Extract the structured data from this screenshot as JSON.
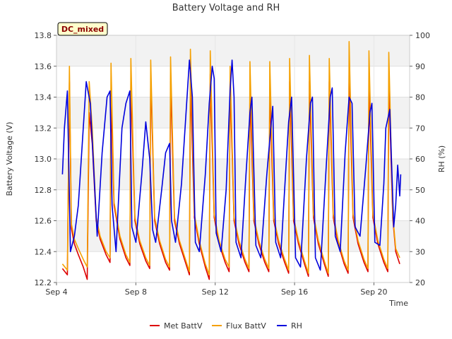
{
  "chart_data": {
    "type": "line",
    "title": "Battery Voltage and RH",
    "badge": "DC_mixed",
    "xlabel": "Time",
    "ylabel": "Battery Voltage (V)",
    "y2label": "RH (%)",
    "x_range_days": [
      4,
      21.8
    ],
    "x_ticks": [
      {
        "day": 4,
        "label": "Sep 4"
      },
      {
        "day": 8,
        "label": "Sep 8"
      },
      {
        "day": 12,
        "label": "Sep 12"
      },
      {
        "day": 16,
        "label": "Sep 16"
      },
      {
        "day": 20,
        "label": "Sep 20"
      }
    ],
    "ylim": [
      12.2,
      13.8
    ],
    "y_ticks": [
      "12.2",
      "12.4",
      "12.6",
      "12.8",
      "13.0",
      "13.2",
      "13.4",
      "13.6",
      "13.8"
    ],
    "y2lim": [
      20,
      100
    ],
    "y2_ticks": [
      "20",
      "30",
      "40",
      "50",
      "60",
      "70",
      "80",
      "90",
      "100"
    ],
    "legend_position": "bottom",
    "series": [
      {
        "name": "Met BattV",
        "axis": "left",
        "color": "#dd0000",
        "points": [
          [
            4.3,
            12.29
          ],
          [
            4.55,
            12.25
          ],
          [
            4.65,
            13.5
          ],
          [
            4.75,
            12.55
          ],
          [
            4.9,
            12.45
          ],
          [
            5.1,
            12.38
          ],
          [
            5.35,
            12.3
          ],
          [
            5.55,
            12.22
          ],
          [
            5.65,
            13.3
          ],
          [
            5.8,
            13.1
          ],
          [
            6.0,
            12.6
          ],
          [
            6.2,
            12.48
          ],
          [
            6.5,
            12.38
          ],
          [
            6.7,
            12.33
          ],
          [
            6.75,
            13.4
          ],
          [
            6.9,
            12.7
          ],
          [
            7.2,
            12.48
          ],
          [
            7.5,
            12.36
          ],
          [
            7.7,
            12.31
          ],
          [
            7.75,
            13.5
          ],
          [
            7.95,
            12.6
          ],
          [
            8.2,
            12.45
          ],
          [
            8.5,
            12.34
          ],
          [
            8.7,
            12.29
          ],
          [
            8.75,
            13.55
          ],
          [
            8.95,
            12.6
          ],
          [
            9.2,
            12.45
          ],
          [
            9.5,
            12.33
          ],
          [
            9.7,
            12.28
          ],
          [
            9.75,
            13.5
          ],
          [
            9.95,
            12.6
          ],
          [
            10.2,
            12.45
          ],
          [
            10.5,
            12.33
          ],
          [
            10.7,
            12.25
          ],
          [
            10.75,
            13.5
          ],
          [
            10.95,
            12.62
          ],
          [
            11.2,
            12.45
          ],
          [
            11.5,
            12.3
          ],
          [
            11.7,
            12.22
          ],
          [
            11.75,
            13.55
          ],
          [
            11.95,
            12.62
          ],
          [
            12.2,
            12.45
          ],
          [
            12.5,
            12.33
          ],
          [
            12.7,
            12.27
          ],
          [
            12.75,
            13.5
          ],
          [
            12.95,
            12.6
          ],
          [
            13.2,
            12.45
          ],
          [
            13.5,
            12.33
          ],
          [
            13.7,
            12.27
          ],
          [
            13.75,
            13.45
          ],
          [
            13.95,
            12.6
          ],
          [
            14.2,
            12.45
          ],
          [
            14.5,
            12.33
          ],
          [
            14.7,
            12.27
          ],
          [
            14.75,
            13.45
          ],
          [
            14.95,
            12.6
          ],
          [
            15.2,
            12.45
          ],
          [
            15.5,
            12.33
          ],
          [
            15.7,
            12.26
          ],
          [
            15.75,
            13.5
          ],
          [
            15.95,
            12.6
          ],
          [
            16.2,
            12.45
          ],
          [
            16.5,
            12.32
          ],
          [
            16.7,
            12.24
          ],
          [
            16.75,
            13.5
          ],
          [
            16.95,
            12.62
          ],
          [
            17.2,
            12.45
          ],
          [
            17.5,
            12.32
          ],
          [
            17.7,
            12.24
          ],
          [
            17.75,
            13.5
          ],
          [
            17.95,
            12.62
          ],
          [
            18.2,
            12.45
          ],
          [
            18.5,
            12.32
          ],
          [
            18.7,
            12.26
          ],
          [
            18.75,
            13.55
          ],
          [
            18.95,
            12.62
          ],
          [
            19.2,
            12.45
          ],
          [
            19.5,
            12.33
          ],
          [
            19.7,
            12.27
          ],
          [
            19.75,
            13.5
          ],
          [
            19.95,
            12.62
          ],
          [
            20.2,
            12.45
          ],
          [
            20.5,
            12.33
          ],
          [
            20.7,
            12.27
          ],
          [
            20.75,
            13.5
          ],
          [
            20.95,
            12.62
          ],
          [
            21.1,
            12.4
          ],
          [
            21.3,
            12.32
          ]
        ]
      },
      {
        "name": "Flux BattV",
        "axis": "left",
        "color": "#f5a000",
        "points": [
          [
            4.3,
            12.32
          ],
          [
            4.55,
            12.28
          ],
          [
            4.65,
            13.6
          ],
          [
            4.75,
            12.58
          ],
          [
            4.9,
            12.48
          ],
          [
            5.1,
            12.42
          ],
          [
            5.35,
            12.35
          ],
          [
            5.55,
            12.3
          ],
          [
            5.65,
            13.5
          ],
          [
            5.8,
            13.2
          ],
          [
            6.0,
            12.62
          ],
          [
            6.2,
            12.5
          ],
          [
            6.5,
            12.4
          ],
          [
            6.7,
            12.36
          ],
          [
            6.75,
            13.62
          ],
          [
            6.9,
            12.72
          ],
          [
            7.2,
            12.5
          ],
          [
            7.5,
            12.38
          ],
          [
            7.7,
            12.33
          ],
          [
            7.75,
            13.65
          ],
          [
            7.95,
            12.62
          ],
          [
            8.2,
            12.47
          ],
          [
            8.5,
            12.36
          ],
          [
            8.7,
            12.31
          ],
          [
            8.75,
            13.64
          ],
          [
            8.95,
            12.62
          ],
          [
            9.2,
            12.47
          ],
          [
            9.5,
            12.35
          ],
          [
            9.7,
            12.3
          ],
          [
            9.75,
            13.66
          ],
          [
            9.95,
            12.62
          ],
          [
            10.2,
            12.47
          ],
          [
            10.5,
            12.35
          ],
          [
            10.7,
            12.27
          ],
          [
            10.75,
            13.71
          ],
          [
            10.95,
            12.64
          ],
          [
            11.2,
            12.47
          ],
          [
            11.5,
            12.32
          ],
          [
            11.7,
            12.25
          ],
          [
            11.75,
            13.7
          ],
          [
            11.95,
            12.64
          ],
          [
            12.2,
            12.47
          ],
          [
            12.5,
            12.35
          ],
          [
            12.7,
            12.3
          ],
          [
            12.75,
            13.6
          ],
          [
            12.95,
            12.62
          ],
          [
            13.2,
            12.47
          ],
          [
            13.5,
            12.35
          ],
          [
            13.7,
            12.29
          ],
          [
            13.75,
            13.63
          ],
          [
            13.95,
            12.62
          ],
          [
            14.2,
            12.47
          ],
          [
            14.5,
            12.35
          ],
          [
            14.7,
            12.29
          ],
          [
            14.75,
            13.63
          ],
          [
            14.95,
            12.62
          ],
          [
            15.2,
            12.47
          ],
          [
            15.5,
            12.35
          ],
          [
            15.7,
            12.28
          ],
          [
            15.75,
            13.65
          ],
          [
            15.95,
            12.62
          ],
          [
            16.2,
            12.47
          ],
          [
            16.5,
            12.34
          ],
          [
            16.7,
            12.26
          ],
          [
            16.75,
            13.67
          ],
          [
            16.95,
            12.64
          ],
          [
            17.2,
            12.47
          ],
          [
            17.5,
            12.34
          ],
          [
            17.7,
            12.26
          ],
          [
            17.75,
            13.65
          ],
          [
            17.95,
            12.64
          ],
          [
            18.2,
            12.47
          ],
          [
            18.5,
            12.34
          ],
          [
            18.7,
            12.28
          ],
          [
            18.75,
            13.76
          ],
          [
            18.95,
            12.64
          ],
          [
            19.2,
            12.47
          ],
          [
            19.5,
            12.35
          ],
          [
            19.7,
            12.29
          ],
          [
            19.75,
            13.7
          ],
          [
            19.95,
            12.64
          ],
          [
            20.2,
            12.47
          ],
          [
            20.5,
            12.35
          ],
          [
            20.7,
            12.29
          ],
          [
            20.75,
            13.69
          ],
          [
            20.95,
            12.64
          ],
          [
            21.1,
            12.42
          ],
          [
            21.3,
            12.36
          ]
        ]
      },
      {
        "name": "RH",
        "axis": "right",
        "color": "#0000dd",
        "points": [
          [
            4.3,
            55
          ],
          [
            4.4,
            70
          ],
          [
            4.55,
            82
          ],
          [
            4.7,
            30
          ],
          [
            4.9,
            35
          ],
          [
            5.1,
            45
          ],
          [
            5.3,
            65
          ],
          [
            5.5,
            85
          ],
          [
            5.7,
            78
          ],
          [
            5.85,
            60
          ],
          [
            6.05,
            35
          ],
          [
            6.3,
            62
          ],
          [
            6.55,
            80
          ],
          [
            6.7,
            82
          ],
          [
            6.8,
            45
          ],
          [
            7.0,
            30
          ],
          [
            7.3,
            70
          ],
          [
            7.5,
            78
          ],
          [
            7.7,
            82
          ],
          [
            7.8,
            38
          ],
          [
            8.0,
            33
          ],
          [
            8.3,
            55
          ],
          [
            8.5,
            72
          ],
          [
            8.7,
            60
          ],
          [
            8.85,
            37
          ],
          [
            9.0,
            33
          ],
          [
            9.3,
            50
          ],
          [
            9.5,
            62
          ],
          [
            9.7,
            65
          ],
          [
            9.8,
            40
          ],
          [
            10.0,
            33
          ],
          [
            10.3,
            52
          ],
          [
            10.5,
            72
          ],
          [
            10.7,
            92
          ],
          [
            10.85,
            80
          ],
          [
            11.0,
            33
          ],
          [
            11.2,
            30
          ],
          [
            11.5,
            55
          ],
          [
            11.7,
            78
          ],
          [
            11.85,
            90
          ],
          [
            11.95,
            86
          ],
          [
            12.05,
            36
          ],
          [
            12.3,
            30
          ],
          [
            12.55,
            50
          ],
          [
            12.75,
            82
          ],
          [
            12.85,
            92
          ],
          [
            12.95,
            80
          ],
          [
            13.05,
            33
          ],
          [
            13.3,
            28
          ],
          [
            13.55,
            55
          ],
          [
            13.75,
            75
          ],
          [
            13.85,
            80
          ],
          [
            14.05,
            32
          ],
          [
            14.3,
            28
          ],
          [
            14.6,
            55
          ],
          [
            14.8,
            70
          ],
          [
            14.9,
            77
          ],
          [
            15.05,
            33
          ],
          [
            15.3,
            28
          ],
          [
            15.5,
            50
          ],
          [
            15.7,
            72
          ],
          [
            15.85,
            80
          ],
          [
            16.05,
            28
          ],
          [
            16.3,
            25
          ],
          [
            16.6,
            60
          ],
          [
            16.8,
            78
          ],
          [
            16.9,
            80
          ],
          [
            17.05,
            28
          ],
          [
            17.3,
            24
          ],
          [
            17.6,
            58
          ],
          [
            17.8,
            80
          ],
          [
            17.9,
            83
          ],
          [
            18.05,
            35
          ],
          [
            18.3,
            30
          ],
          [
            18.55,
            62
          ],
          [
            18.75,
            80
          ],
          [
            18.9,
            78
          ],
          [
            19.05,
            38
          ],
          [
            19.3,
            35
          ],
          [
            19.6,
            58
          ],
          [
            19.8,
            75
          ],
          [
            19.9,
            78
          ],
          [
            20.05,
            33
          ],
          [
            20.3,
            32
          ],
          [
            20.5,
            52
          ],
          [
            20.6,
            70
          ],
          [
            20.8,
            76
          ],
          [
            21.0,
            38
          ],
          [
            21.1,
            45
          ],
          [
            21.2,
            58
          ],
          [
            21.3,
            48
          ],
          [
            21.35,
            55
          ]
        ]
      }
    ]
  }
}
